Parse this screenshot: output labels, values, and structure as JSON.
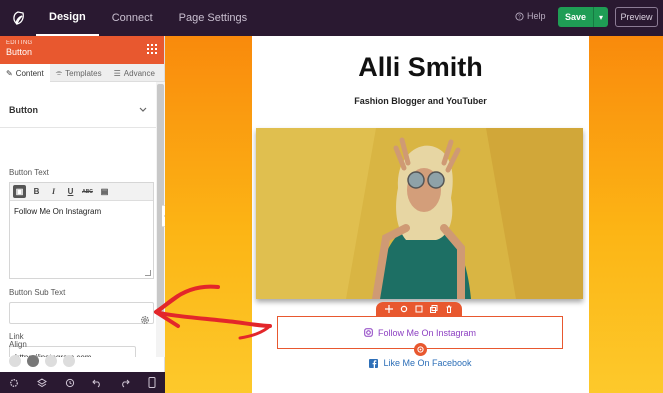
{
  "topbar": {
    "tabs": [
      {
        "label": "Design",
        "active": true
      },
      {
        "label": "Connect",
        "active": false
      },
      {
        "label": "Page Settings",
        "active": false
      }
    ],
    "help_label": "Help",
    "save_label": "Save",
    "preview_label": "Preview"
  },
  "sidebar": {
    "header_small": "EDITING",
    "header_title": "Button",
    "tabs": [
      {
        "label": "Content",
        "icon": "pencil-icon"
      },
      {
        "label": "Templates",
        "icon": "brush-icon"
      },
      {
        "label": "Advance",
        "icon": "sliders-icon"
      }
    ],
    "section_title": "Button",
    "button_text_label": "Button Text",
    "button_text_value": "Follow Me On Instagram",
    "toolbar_buttons": [
      "B",
      "I",
      "U",
      "ABC"
    ],
    "sub_text_label": "Button Sub Text",
    "sub_text_value": "",
    "link_label": "Link",
    "link_value": "https://instagram.com",
    "align_label": "Align"
  },
  "canvas": {
    "name": "Alli Smith",
    "tagline": "Fashion Blogger and YouTuber",
    "primary_button": "Follow Me On Instagram",
    "secondary_button": "Like Me On Facebook"
  },
  "colors": {
    "topbar": "#2a1931",
    "accent": "#e8582f",
    "save": "#1f9d55",
    "instagram": "#8c3fc2",
    "facebook": "#2d6fb8"
  }
}
